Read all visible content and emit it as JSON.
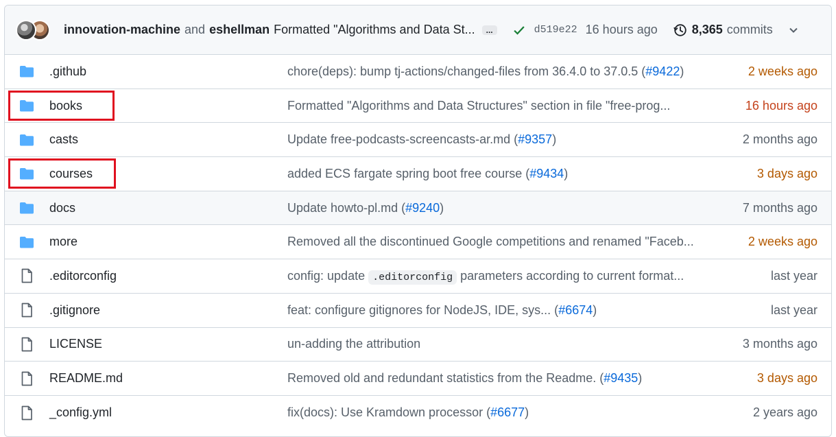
{
  "header": {
    "author1": "innovation-machine",
    "and_text": "and",
    "author2": "eshellman",
    "message": "Formatted \"Algorithms and Data St...",
    "ellipsis": "...",
    "sha": "d519e22",
    "time": "16 hours ago",
    "commit_count": "8,365",
    "commits_label": "commits"
  },
  "files": [
    {
      "type": "folder",
      "name": ".github",
      "msg_pre": "chore(deps): bump tj-actions/changed-files from 36.4.0 to 37.0.5 (",
      "link": "#9422",
      "msg_post": ")",
      "age": "2 weeks ago"
    },
    {
      "type": "folder",
      "name": "books",
      "msg_pre": "Formatted \"Algorithms and Data Structures\" section in file \"free-prog...",
      "link": "",
      "msg_post": "",
      "age": "16 hours ago"
    },
    {
      "type": "folder",
      "name": "casts",
      "msg_pre": "Update free-podcasts-screencasts-ar.md (",
      "link": "#9357",
      "msg_post": ")",
      "age": "2 months ago"
    },
    {
      "type": "folder",
      "name": "courses",
      "msg_pre": "added ECS fargate spring boot free course (",
      "link": "#9434",
      "msg_post": ")",
      "age": "3 days ago"
    },
    {
      "type": "folder",
      "name": "docs",
      "msg_pre": "Update howto-pl.md (",
      "link": "#9240",
      "msg_post": ")",
      "age": "7 months ago"
    },
    {
      "type": "folder",
      "name": "more",
      "msg_pre": "Removed all the discontinued Google competitions and renamed \"Faceb...",
      "link": "",
      "msg_post": "",
      "age": "2 weeks ago"
    },
    {
      "type": "file",
      "name": ".editorconfig",
      "msg_pre": "config: update ",
      "code": ".editorconfig",
      "msg_post": " parameters according to current format...",
      "link": "",
      "age": "last year"
    },
    {
      "type": "file",
      "name": ".gitignore",
      "msg_pre": "feat: configure gitignores for NodeJS, IDE, sys... (",
      "link": "#6674",
      "msg_post": ")",
      "age": "last year"
    },
    {
      "type": "file",
      "name": "LICENSE",
      "msg_pre": "un-adding the attribution",
      "link": "",
      "msg_post": "",
      "age": "3 months ago"
    },
    {
      "type": "file",
      "name": "README.md",
      "msg_pre": "Removed old and redundant statistics from the Readme. (",
      "link": "#9435",
      "msg_post": ")",
      "age": "3 days ago"
    },
    {
      "type": "file",
      "name": "_config.yml",
      "msg_pre": "fix(docs): Use Kramdown processor (",
      "link": "#6677",
      "msg_post": ")",
      "age": "2 years ago"
    }
  ],
  "colors": {
    "folder": "#54aeff",
    "highlight": "#e0101f",
    "link": "#0969da",
    "check": "#1a7f37"
  }
}
